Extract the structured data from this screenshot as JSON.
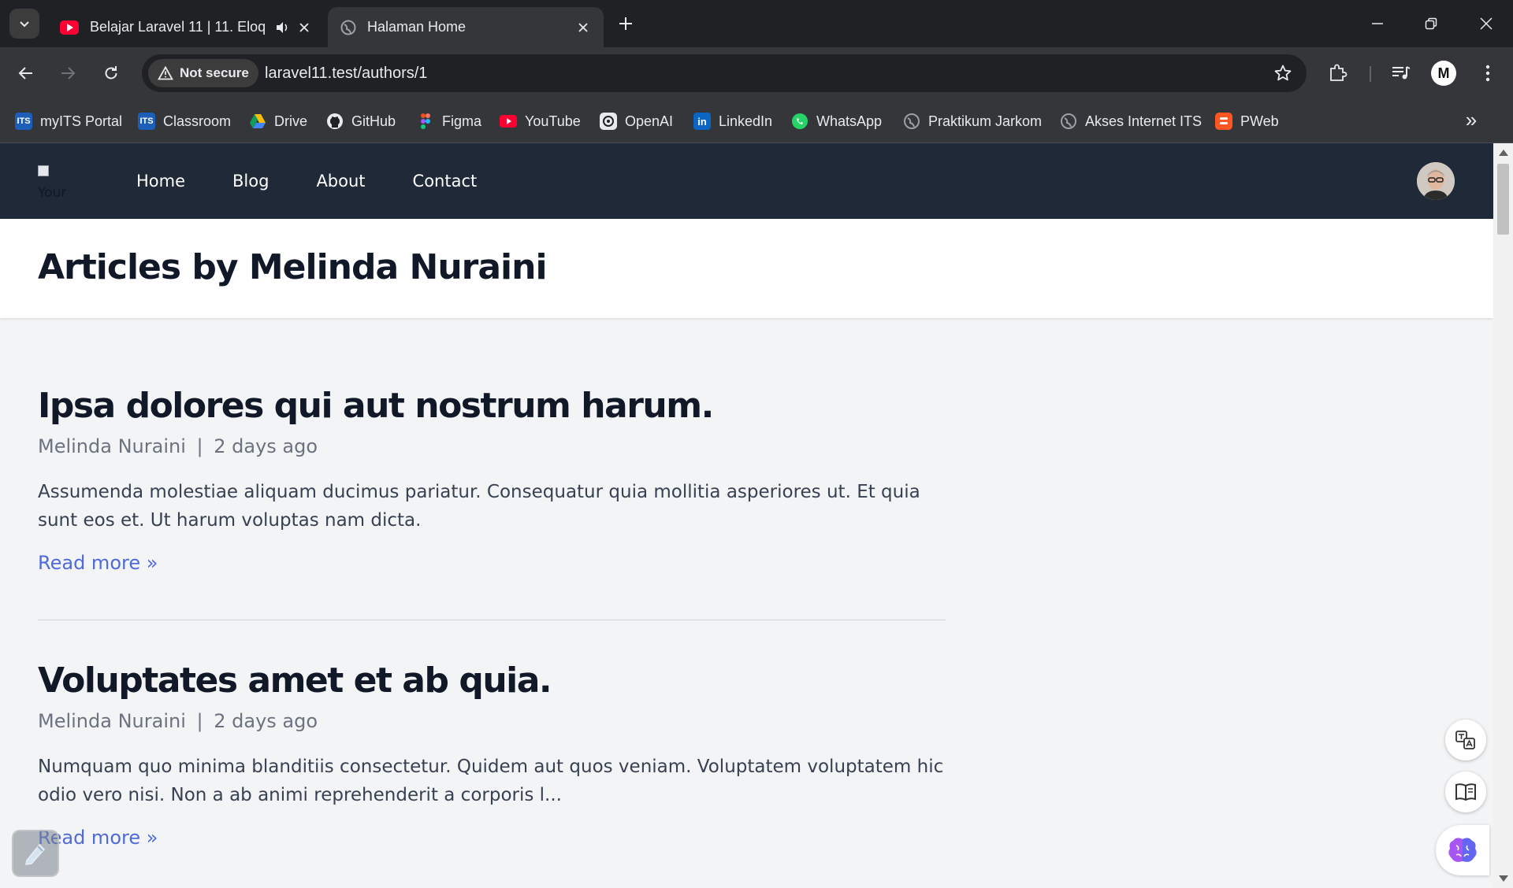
{
  "browser": {
    "tabs": [
      {
        "title": "Belajar Laravel 11 | 11. Eloq",
        "icon": "youtube-icon",
        "audio": true
      },
      {
        "title": "Halaman Home",
        "icon": "globe-icon"
      }
    ],
    "address": {
      "security_label": "Not secure",
      "url": "laravel11.test/authors/1"
    },
    "profile_initial": "M",
    "bookmarks": [
      {
        "label": "myITS Portal",
        "icon": "its-icon"
      },
      {
        "label": "Classroom",
        "icon": "its-icon"
      },
      {
        "label": "Drive",
        "icon": "drive-icon"
      },
      {
        "label": "GitHub",
        "icon": "github-icon"
      },
      {
        "label": "Figma",
        "icon": "figma-icon"
      },
      {
        "label": "YouTube",
        "icon": "youtube-icon"
      },
      {
        "label": "OpenAI",
        "icon": "openai-icon"
      },
      {
        "label": "LinkedIn",
        "icon": "linkedin-icon"
      },
      {
        "label": "WhatsApp",
        "icon": "whatsapp-icon"
      },
      {
        "label": "Praktikum Jarkom",
        "icon": "globe-icon"
      },
      {
        "label": "Akses Internet ITS",
        "icon": "globe-icon"
      },
      {
        "label": "PWeb",
        "icon": "blogger-icon"
      }
    ],
    "bookmarks_overflow": "»"
  },
  "site": {
    "logo_alt": "Your",
    "nav": [
      "Home",
      "Blog",
      "About",
      "Contact"
    ],
    "page_title": "Articles by Melinda Nuraini",
    "articles": [
      {
        "title": "Ipsa dolores qui aut nostrum harum.",
        "author": "Melinda Nuraini",
        "separator": "|",
        "date": "2 days ago",
        "excerpt": "Assumenda molestiae aliquam ducimus pariatur. Consequatur quia mollitia asperiores ut. Et quia sunt eos et. Ut harum voluptas nam dicta.",
        "read_more": "Read more »"
      },
      {
        "title": "Voluptates amet et ab quia.",
        "author": "Melinda Nuraini",
        "separator": "|",
        "date": "2 days ago",
        "excerpt": "Numquam quo minima blanditiis consectetur. Quidem aut quos veniam. Voluptatem voluptatem hic odio vero nisi. Non a ab animi reprehenderit a corporis l...",
        "read_more": "Read more »"
      }
    ]
  },
  "colors": {
    "nav_bg": "#1f2937",
    "link": "#4f6ad9",
    "page_bg": "#f3f4f6"
  }
}
